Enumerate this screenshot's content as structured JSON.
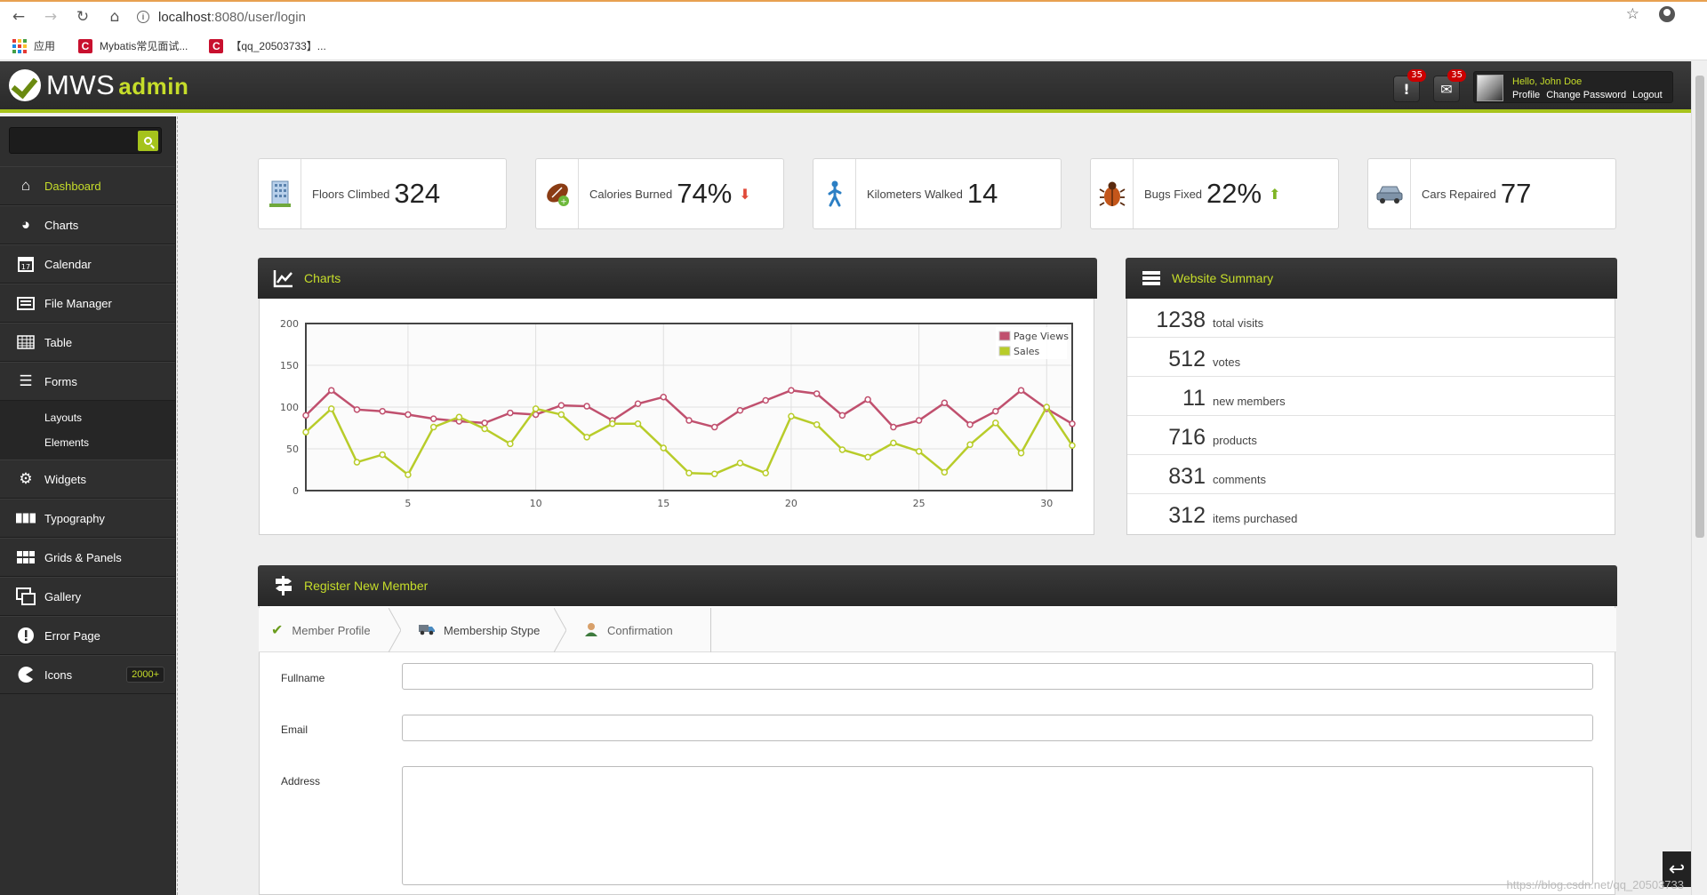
{
  "browser": {
    "url_host": "localhost",
    "url_path": ":8080/user/login",
    "bookmarks": [
      {
        "label": "应用"
      },
      {
        "label": "Mybatis常见面试..."
      },
      {
        "label": "【qq_20503733】..."
      }
    ]
  },
  "header": {
    "logo_main": "MWS",
    "logo_sub": "admin",
    "notifications_count": "35",
    "messages_count": "35",
    "greeting": "Hello, John Doe",
    "user_links": [
      "Profile",
      "Change Password",
      "Logout"
    ]
  },
  "sidebar": {
    "search_placeholder": "",
    "items": [
      {
        "label": "Dashboard",
        "icon": "home-icon",
        "active": true
      },
      {
        "label": "Charts",
        "icon": "pie-chart-icon"
      },
      {
        "label": "Calendar",
        "icon": "calendar-icon"
      },
      {
        "label": "File Manager",
        "icon": "file-manager-icon"
      },
      {
        "label": "Table",
        "icon": "table-icon"
      },
      {
        "label": "Forms",
        "icon": "list-icon"
      },
      {
        "label": "Widgets",
        "icon": "gear-icon"
      },
      {
        "label": "Typography",
        "icon": "typography-icon"
      },
      {
        "label": "Grids & Panels",
        "icon": "grid-icon"
      },
      {
        "label": "Gallery",
        "icon": "gallery-icon"
      },
      {
        "label": "Error Page",
        "icon": "error-icon"
      },
      {
        "label": "Icons",
        "icon": "pacman-icon",
        "badge": "2000+"
      }
    ],
    "forms_sub": [
      "Layouts",
      "Elements"
    ]
  },
  "stats": [
    {
      "label": "Floors Climbed",
      "value": "324",
      "icon": "building-icon"
    },
    {
      "label": "Calories Burned",
      "value": "74%",
      "icon": "football-icon",
      "trend": "down"
    },
    {
      "label": "Kilometers Walked",
      "value": "14",
      "icon": "walking-man-icon"
    },
    {
      "label": "Bugs Fixed",
      "value": "22%",
      "icon": "bug-icon",
      "trend": "up"
    },
    {
      "label": "Cars Repaired",
      "value": "77",
      "icon": "car-icon"
    }
  ],
  "charts_panel": {
    "title": "Charts"
  },
  "summary_panel": {
    "title": "Website Summary",
    "rows": [
      {
        "num": "1238",
        "label": "total visits"
      },
      {
        "num": "512",
        "label": "votes"
      },
      {
        "num": "11",
        "label": "new members"
      },
      {
        "num": "716",
        "label": "products"
      },
      {
        "num": "831",
        "label": "comments"
      },
      {
        "num": "312",
        "label": "items purchased"
      }
    ]
  },
  "register_panel": {
    "title": "Register New Member",
    "steps": [
      "Member Profile",
      "Membership Stype",
      "Confirmation"
    ],
    "fields": [
      "Fullname",
      "Email",
      "Address"
    ]
  },
  "watermark": "https://blog.csdn.net/qq_20503733",
  "colors": {
    "accent": "#c6dd2a",
    "page_views": "#c0506e",
    "sales": "#b8cc2a"
  },
  "chart_data": {
    "type": "line",
    "x": [
      1,
      2,
      3,
      4,
      5,
      6,
      7,
      8,
      9,
      10,
      11,
      12,
      13,
      14,
      15,
      16,
      17,
      18,
      19,
      20,
      21,
      22,
      23,
      24,
      25,
      26,
      27,
      28,
      29,
      30,
      31
    ],
    "series": [
      {
        "name": "Page Views",
        "values": [
          90,
          120,
          97,
          95,
          91,
          86,
          83,
          81,
          93,
          91,
          102,
          101,
          84,
          104,
          112,
          84,
          76,
          96,
          108,
          120,
          116,
          90,
          109,
          76,
          84,
          105,
          79,
          95,
          120,
          98,
          80
        ]
      },
      {
        "name": "Sales",
        "values": [
          70,
          98,
          34,
          43,
          19,
          76,
          88,
          74,
          56,
          98,
          91,
          64,
          80,
          80,
          51,
          21,
          20,
          33,
          21,
          89,
          79,
          49,
          40,
          57,
          47,
          22,
          55,
          81,
          45,
          100,
          54
        ]
      }
    ],
    "xticks": [
      5,
      10,
      15,
      20,
      25,
      30
    ],
    "yticks": [
      0,
      50,
      100,
      150,
      200
    ],
    "xlim": [
      1,
      31
    ],
    "ylim": [
      0,
      200
    ],
    "legend": "top-right",
    "grid": true
  }
}
